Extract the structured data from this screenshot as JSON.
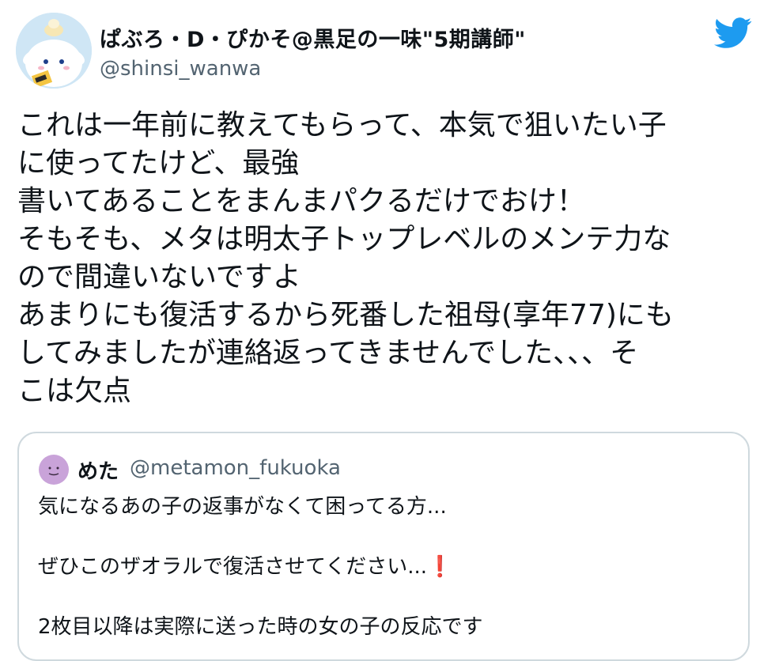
{
  "author": {
    "display_name": "ぱぶろ・D・ぴかそ@黒足の一味\"5期講師\"",
    "handle": "@shinsi_wanwa"
  },
  "icons": {
    "logo": "twitter-bird-icon",
    "avatar": "cinnamoroll-avatar",
    "quote_avatar": "ditto-avatar"
  },
  "colors": {
    "twitter_blue": "#1d9bf0",
    "text": "#0f1419",
    "secondary": "#536471",
    "border": "#cfd9de",
    "exclamation": "#c0122b"
  },
  "tweet": {
    "lines": [
      "これは一年前に教えてもらって、本気で狙いたい子",
      "に使ってたけど、最強",
      "書いてあることをまんまパクるだけでおけ！",
      "そもそも、メタは明太子トップレベルのメンテ力な",
      "ので間違いないですよ",
      "あまりにも復活するから死番した祖母(享年77)にも",
      "してみましたが連絡返ってきませんでした、、、そ",
      "こは欠点"
    ]
  },
  "quote": {
    "name": "めた",
    "handle": "@metamon_fukuoka",
    "line1": "気になるあの子の返事がなくて困ってる方...",
    "line2": "",
    "line3": "ぜひこのザオラルで復活させてください...",
    "line3_emoji": "❗",
    "line4": "",
    "line5": "2枚目以降は実際に送った時の女の子の反応です"
  }
}
